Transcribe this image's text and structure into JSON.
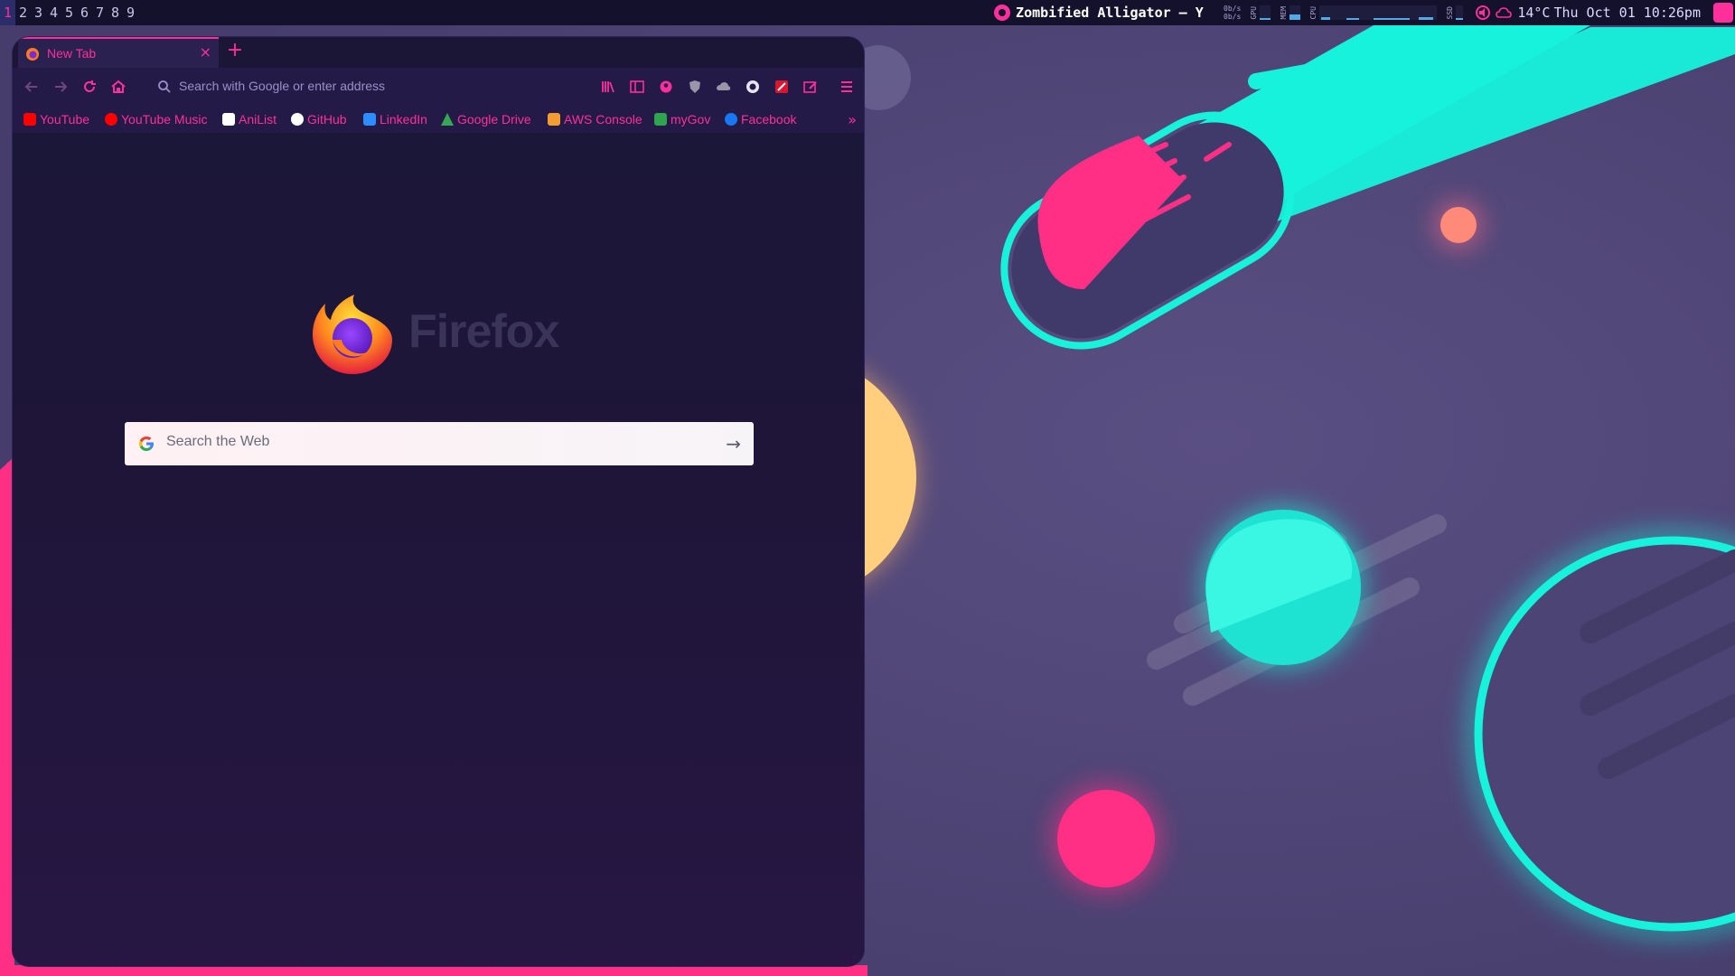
{
  "topbar": {
    "workspaces": [
      "1",
      "2",
      "3",
      "4",
      "5",
      "6",
      "7",
      "8",
      "9"
    ],
    "active_workspace": "1",
    "music_title": "Zombified Alligator – Y",
    "net_up": "0b/s",
    "net_down": "0b/s",
    "gpu_label": "GPU",
    "mem_label": "MEM",
    "cpu_label": "CPU",
    "ssd_label": "SSD",
    "weather": "14°C",
    "clock": "Thu Oct 01 10:26pm"
  },
  "browser": {
    "tab_title": "New Tab",
    "tab_close": "×",
    "new_tab": "+",
    "url_placeholder": "Search with Google or enter address",
    "bookmarks": [
      {
        "label": "YouTube",
        "icon": "youtube-icon",
        "color": "#ff0000"
      },
      {
        "label": "YouTube Music",
        "icon": "youtube-music-icon",
        "color": "#ff0000"
      },
      {
        "label": "AniList",
        "icon": "anilist-icon",
        "color": "#ffffff"
      },
      {
        "label": "GitHub",
        "icon": "github-icon",
        "color": "#ffffff"
      },
      {
        "label": "LinkedIn",
        "icon": "linkedin-icon",
        "color": "#2d8cff"
      },
      {
        "label": "Google Drive",
        "icon": "google-drive-icon",
        "color": "#34a853"
      },
      {
        "label": "AWS Console",
        "icon": "aws-icon",
        "color": "#f39c32"
      },
      {
        "label": "myGov",
        "icon": "mygov-icon",
        "color": "#2ea44f"
      },
      {
        "label": "Facebook",
        "icon": "facebook-icon",
        "color": "#1877f2"
      }
    ],
    "bookmarks_more": "»",
    "brand_wordmark": "Firefox",
    "websearch_placeholder": "Search the Web",
    "websearch_go": "→"
  },
  "colors": {
    "accent": "#ff2f9b",
    "cyan": "#16f2dc",
    "bar_bg": "#13112b",
    "window_bg": "#1a1233"
  }
}
